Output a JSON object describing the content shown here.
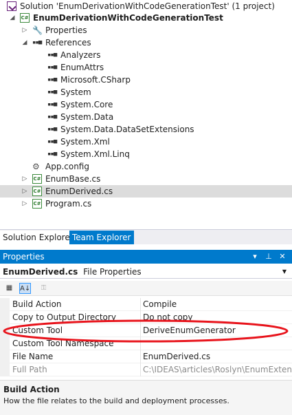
{
  "solution_explorer": {
    "items": [
      {
        "label": "Solution 'EnumDerivationWithCodeGenerationTest' (1 project)",
        "icon": "solution-icon",
        "expander": ""
      },
      {
        "label": "EnumDerivationWithCodeGenerationTest",
        "icon": "csharp-project-icon",
        "expander": "◢",
        "bold": true
      },
      {
        "label": "Properties",
        "icon": "wrench-icon",
        "expander": "▷"
      },
      {
        "label": "References",
        "icon": "reference-icon",
        "expander": "◢"
      },
      {
        "label": "Analyzers",
        "icon": "reference-icon",
        "expander": ""
      },
      {
        "label": "EnumAttrs",
        "icon": "reference-icon",
        "expander": ""
      },
      {
        "label": "Microsoft.CSharp",
        "icon": "reference-icon",
        "expander": ""
      },
      {
        "label": "System",
        "icon": "reference-icon",
        "expander": ""
      },
      {
        "label": "System.Core",
        "icon": "reference-icon",
        "expander": ""
      },
      {
        "label": "System.Data",
        "icon": "reference-icon",
        "expander": ""
      },
      {
        "label": "System.Data.DataSetExtensions",
        "icon": "reference-icon",
        "expander": ""
      },
      {
        "label": "System.Xml",
        "icon": "reference-icon",
        "expander": ""
      },
      {
        "label": "System.Xml.Linq",
        "icon": "reference-icon",
        "expander": ""
      },
      {
        "label": "App.config",
        "icon": "config-file-icon",
        "expander": ""
      },
      {
        "label": "EnumBase.cs",
        "icon": "csharp-file-icon",
        "expander": "▷"
      },
      {
        "label": "EnumDerived.cs",
        "icon": "csharp-file-icon",
        "expander": "▷",
        "selected": true
      },
      {
        "label": "Program.cs",
        "icon": "csharp-file-icon",
        "expander": "▷"
      }
    ],
    "icon_glyphs": {
      "csharp": "C#",
      "reference": "▪▪■",
      "wrench": "🔧",
      "config": "⚙"
    }
  },
  "tabs": {
    "solution_explorer": "Solution Explorer",
    "team_explorer": "Team Explorer"
  },
  "properties": {
    "title": "Properties",
    "title_buttons": {
      "dropdown": "▾",
      "pin": "⊥",
      "close": "✕"
    },
    "object_name": "EnumDerived.cs",
    "object_type": "File Properties",
    "toolbar": {
      "categorized": "▦",
      "alphabetical": "A↓",
      "property_pages": "⚿"
    },
    "rows": [
      {
        "name": "Build Action",
        "value": "Compile"
      },
      {
        "name": "Copy to Output Directory",
        "value": "Do not copy"
      },
      {
        "name": "Custom Tool",
        "value": "DeriveEnumGenerator"
      },
      {
        "name": "Custom Tool Namespace",
        "value": ""
      },
      {
        "name": "File Name",
        "value": "EnumDerived.cs"
      },
      {
        "name": "Full Path",
        "value": "C:\\IDEAS\\articles\\Roslyn\\EnumExtension",
        "readonly": true
      }
    ],
    "description": {
      "title": "Build Action",
      "text": "How the file relates to the build and deployment processes."
    }
  },
  "colors": {
    "accent": "#007acc",
    "highlight_ellipse": "#e8141c",
    "selected_row": "#dcdcdc"
  }
}
